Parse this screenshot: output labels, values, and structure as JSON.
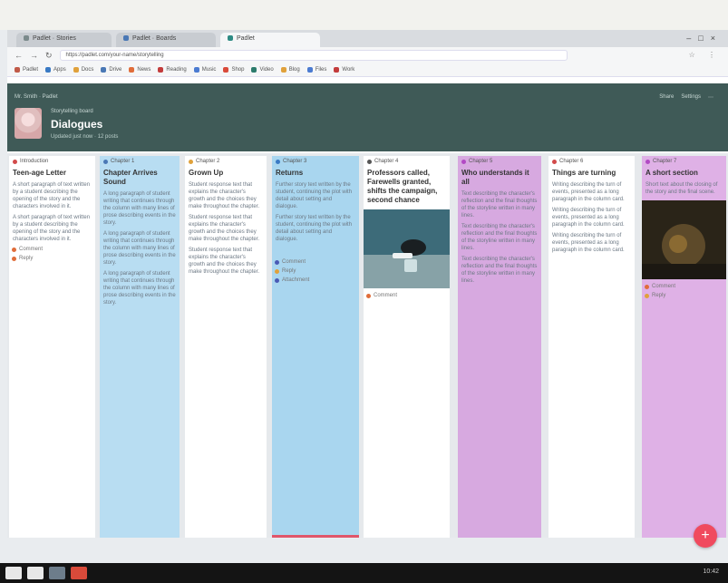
{
  "browser": {
    "tabs": [
      {
        "label": "Padlet · Stories",
        "color": "#7b8a8b"
      },
      {
        "label": "Padlet · Boards",
        "color": "#4a78b5"
      },
      {
        "label": "Padlet",
        "color": "#2e8b84"
      }
    ],
    "url": "https://padlet.com/your-name/storytelling",
    "bookmarks": [
      {
        "label": "Padlet",
        "color": "#c05a48"
      },
      {
        "label": "Apps",
        "color": "#3a7ac4"
      },
      {
        "label": "Docs",
        "color": "#e0a13b"
      },
      {
        "label": "Drive",
        "color": "#4a78b5"
      },
      {
        "label": "News",
        "color": "#e06d3a"
      },
      {
        "label": "Reading",
        "color": "#c33c3c"
      },
      {
        "label": "Music",
        "color": "#4b7bd1"
      },
      {
        "label": "Shop",
        "color": "#d94a3a"
      },
      {
        "label": "Video",
        "color": "#2c7b6c"
      },
      {
        "label": "Blog",
        "color": "#e0a13b"
      },
      {
        "label": "Files",
        "color": "#4b7bd1"
      },
      {
        "label": "Work",
        "color": "#c33c3c"
      }
    ]
  },
  "board": {
    "user_line": "Mr. Smith · Padlet",
    "actions": [
      "Share",
      "Settings",
      "⋯"
    ],
    "subtitle": "Storytelling board",
    "title": "Dialogues",
    "meta": "Updated just now · 12 posts"
  },
  "columns": [
    {
      "header": "Introduction",
      "title": "Teen-age Letter",
      "body": "A short paragraph of text written by a student describing the opening of the story and the characters involved in it.",
      "subs": [
        "Comment",
        "Reply"
      ],
      "color": "#ffffff",
      "dot": "#d24a4a"
    },
    {
      "header": "Chapter 1",
      "title": "Chapter Arrives Sound",
      "body": "A long paragraph of student writing that continues through the column with many lines of prose describing events in the story.",
      "subs": [],
      "color": "#b8ddf2",
      "dot": "#4a78b5"
    },
    {
      "header": "Chapter 2",
      "title": "Grown Up",
      "body": "Student response text that explains the character's growth and the choices they make throughout the chapter.",
      "subs": [],
      "color": "#ffffff",
      "dot": "#e0a13b"
    },
    {
      "header": "Chapter 3",
      "title": "Returns",
      "body": "Further story text written by the student, continuing the plot with detail about setting and dialogue.",
      "subs": [
        "Comment",
        "Reply",
        "Attachment"
      ],
      "color": "#a9d6ef",
      "dot": "#3a7ac4"
    },
    {
      "header": "Chapter 4",
      "title": "Professors called, Farewells granted, shifts the campaign, second chance",
      "body": "",
      "subs": [
        "Comment"
      ],
      "color": "#ffffff",
      "dot": "#555555"
    },
    {
      "header": "Chapter 5",
      "title": "Who understands it all",
      "body": "Text describing the character's reflection and the final thoughts of the storyline written in many lines.",
      "subs": [],
      "color": "#d7a9e0",
      "dot": "#b24ac4"
    },
    {
      "header": "Chapter 6",
      "title": "Things are turning",
      "body": "Writing describing the turn of events, presented as a long paragraph in the column card.",
      "subs": [],
      "color": "#ffffff",
      "dot": "#d24a4a"
    },
    {
      "header": "Chapter 7",
      "title": "A short section",
      "body": "Short text about the closing of the story and the final scene.",
      "subs": [
        "Comment",
        "Reply"
      ],
      "color": "#dfb1e6",
      "dot": "#b24ac4"
    }
  ],
  "fab": "+",
  "taskbar": {
    "clock": "10:42"
  }
}
